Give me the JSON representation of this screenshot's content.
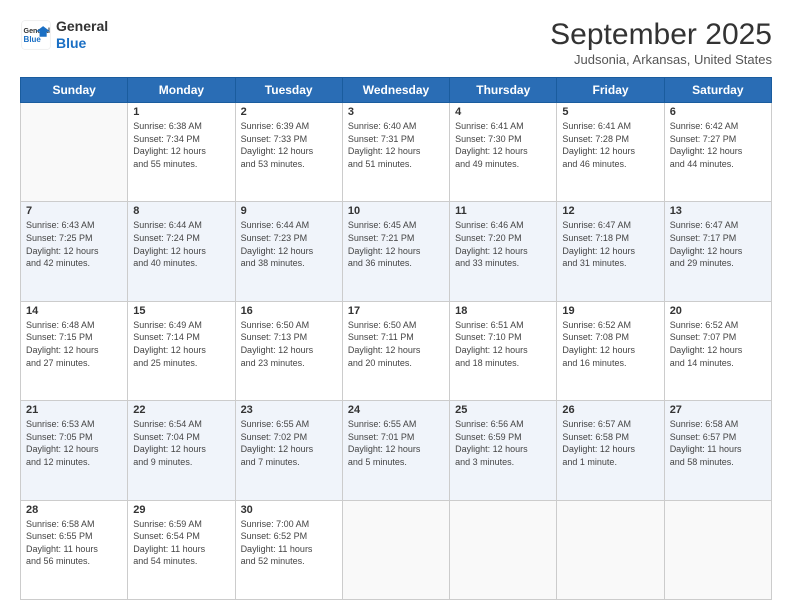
{
  "header": {
    "logo_line1": "General",
    "logo_line2": "Blue",
    "month": "September 2025",
    "location": "Judsonia, Arkansas, United States"
  },
  "days_of_week": [
    "Sunday",
    "Monday",
    "Tuesday",
    "Wednesday",
    "Thursday",
    "Friday",
    "Saturday"
  ],
  "weeks": [
    [
      {
        "num": "",
        "info": ""
      },
      {
        "num": "1",
        "info": "Sunrise: 6:38 AM\nSunset: 7:34 PM\nDaylight: 12 hours\nand 55 minutes."
      },
      {
        "num": "2",
        "info": "Sunrise: 6:39 AM\nSunset: 7:33 PM\nDaylight: 12 hours\nand 53 minutes."
      },
      {
        "num": "3",
        "info": "Sunrise: 6:40 AM\nSunset: 7:31 PM\nDaylight: 12 hours\nand 51 minutes."
      },
      {
        "num": "4",
        "info": "Sunrise: 6:41 AM\nSunset: 7:30 PM\nDaylight: 12 hours\nand 49 minutes."
      },
      {
        "num": "5",
        "info": "Sunrise: 6:41 AM\nSunset: 7:28 PM\nDaylight: 12 hours\nand 46 minutes."
      },
      {
        "num": "6",
        "info": "Sunrise: 6:42 AM\nSunset: 7:27 PM\nDaylight: 12 hours\nand 44 minutes."
      }
    ],
    [
      {
        "num": "7",
        "info": "Sunrise: 6:43 AM\nSunset: 7:25 PM\nDaylight: 12 hours\nand 42 minutes."
      },
      {
        "num": "8",
        "info": "Sunrise: 6:44 AM\nSunset: 7:24 PM\nDaylight: 12 hours\nand 40 minutes."
      },
      {
        "num": "9",
        "info": "Sunrise: 6:44 AM\nSunset: 7:23 PM\nDaylight: 12 hours\nand 38 minutes."
      },
      {
        "num": "10",
        "info": "Sunrise: 6:45 AM\nSunset: 7:21 PM\nDaylight: 12 hours\nand 36 minutes."
      },
      {
        "num": "11",
        "info": "Sunrise: 6:46 AM\nSunset: 7:20 PM\nDaylight: 12 hours\nand 33 minutes."
      },
      {
        "num": "12",
        "info": "Sunrise: 6:47 AM\nSunset: 7:18 PM\nDaylight: 12 hours\nand 31 minutes."
      },
      {
        "num": "13",
        "info": "Sunrise: 6:47 AM\nSunset: 7:17 PM\nDaylight: 12 hours\nand 29 minutes."
      }
    ],
    [
      {
        "num": "14",
        "info": "Sunrise: 6:48 AM\nSunset: 7:15 PM\nDaylight: 12 hours\nand 27 minutes."
      },
      {
        "num": "15",
        "info": "Sunrise: 6:49 AM\nSunset: 7:14 PM\nDaylight: 12 hours\nand 25 minutes."
      },
      {
        "num": "16",
        "info": "Sunrise: 6:50 AM\nSunset: 7:13 PM\nDaylight: 12 hours\nand 23 minutes."
      },
      {
        "num": "17",
        "info": "Sunrise: 6:50 AM\nSunset: 7:11 PM\nDaylight: 12 hours\nand 20 minutes."
      },
      {
        "num": "18",
        "info": "Sunrise: 6:51 AM\nSunset: 7:10 PM\nDaylight: 12 hours\nand 18 minutes."
      },
      {
        "num": "19",
        "info": "Sunrise: 6:52 AM\nSunset: 7:08 PM\nDaylight: 12 hours\nand 16 minutes."
      },
      {
        "num": "20",
        "info": "Sunrise: 6:52 AM\nSunset: 7:07 PM\nDaylight: 12 hours\nand 14 minutes."
      }
    ],
    [
      {
        "num": "21",
        "info": "Sunrise: 6:53 AM\nSunset: 7:05 PM\nDaylight: 12 hours\nand 12 minutes."
      },
      {
        "num": "22",
        "info": "Sunrise: 6:54 AM\nSunset: 7:04 PM\nDaylight: 12 hours\nand 9 minutes."
      },
      {
        "num": "23",
        "info": "Sunrise: 6:55 AM\nSunset: 7:02 PM\nDaylight: 12 hours\nand 7 minutes."
      },
      {
        "num": "24",
        "info": "Sunrise: 6:55 AM\nSunset: 7:01 PM\nDaylight: 12 hours\nand 5 minutes."
      },
      {
        "num": "25",
        "info": "Sunrise: 6:56 AM\nSunset: 6:59 PM\nDaylight: 12 hours\nand 3 minutes."
      },
      {
        "num": "26",
        "info": "Sunrise: 6:57 AM\nSunset: 6:58 PM\nDaylight: 12 hours\nand 1 minute."
      },
      {
        "num": "27",
        "info": "Sunrise: 6:58 AM\nSunset: 6:57 PM\nDaylight: 11 hours\nand 58 minutes."
      }
    ],
    [
      {
        "num": "28",
        "info": "Sunrise: 6:58 AM\nSunset: 6:55 PM\nDaylight: 11 hours\nand 56 minutes."
      },
      {
        "num": "29",
        "info": "Sunrise: 6:59 AM\nSunset: 6:54 PM\nDaylight: 11 hours\nand 54 minutes."
      },
      {
        "num": "30",
        "info": "Sunrise: 7:00 AM\nSunset: 6:52 PM\nDaylight: 11 hours\nand 52 minutes."
      },
      {
        "num": "",
        "info": ""
      },
      {
        "num": "",
        "info": ""
      },
      {
        "num": "",
        "info": ""
      },
      {
        "num": "",
        "info": ""
      }
    ]
  ]
}
